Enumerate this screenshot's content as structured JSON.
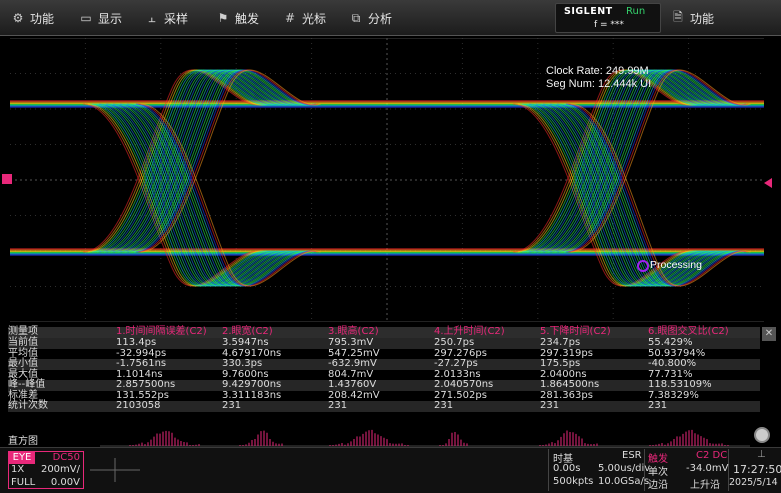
{
  "menu": {
    "items": [
      {
        "label": "功能",
        "icon": "gear-icon",
        "glyph": "⚙"
      },
      {
        "label": "显示",
        "icon": "display-icon",
        "glyph": "▭"
      },
      {
        "label": "采样",
        "icon": "acquire-icon",
        "glyph": "⫠"
      },
      {
        "label": "触发",
        "icon": "trigger-icon",
        "glyph": "⚑"
      },
      {
        "label": "光标",
        "icon": "cursor-icon",
        "glyph": "#"
      },
      {
        "label": "分析",
        "icon": "analysis-icon",
        "glyph": "⧉"
      }
    ],
    "brand": "SIGLENT",
    "run_status": "Run",
    "freq": "f = ***",
    "right_function": {
      "label": "功能",
      "icon": "file-icon",
      "glyph": "🗎"
    }
  },
  "scope": {
    "clock_rate": "Clock Rate: 249.99M",
    "seg_num": "Seg Num: 12.444k UI",
    "processing": "Processing"
  },
  "measurements": {
    "row_header": "测量项",
    "columns": [
      "1.时间间隔误差(C2)",
      "2.眼宽(C2)",
      "3.眼高(C2)",
      "4.上升时间(C2)",
      "5.下降时间(C2)",
      "6.眼图交叉比(C2)"
    ],
    "rows": [
      {
        "label": "当前值",
        "values": [
          "113.4ps",
          "3.5947ns",
          "795.3mV",
          "250.7ps",
          "234.7ps",
          "55.429%"
        ]
      },
      {
        "label": "平均值",
        "values": [
          "-32.994ps",
          "4.679170ns",
          "547.25mV",
          "297.276ps",
          "297.319ps",
          "50.93794%"
        ]
      },
      {
        "label": "最小值",
        "values": [
          "-1.7561ns",
          "330.3ps",
          "-632.9mV",
          "-27.27ps",
          "175.5ps",
          "-40.800%"
        ]
      },
      {
        "label": "最大值",
        "values": [
          "1.1014ns",
          "9.7600ns",
          "804.7mV",
          "2.0133ns",
          "2.0400ns",
          "77.731%"
        ]
      },
      {
        "label": "峰--峰值",
        "values": [
          "2.857500ns",
          "9.429700ns",
          "1.43760V",
          "2.040570ns",
          "1.864500ns",
          "118.53109%"
        ]
      },
      {
        "label": "标准差",
        "values": [
          "131.552ps",
          "3.311183ns",
          "208.42mV",
          "271.502ps",
          "281.363ps",
          "7.38329%"
        ]
      },
      {
        "label": "统计次数",
        "values": [
          "2103058",
          "231",
          "231",
          "231",
          "231",
          "231"
        ]
      }
    ],
    "histogram_label": "直方图",
    "close_glyph": "✕"
  },
  "channel": {
    "mode": "EYE",
    "coupling": "DC50",
    "probe": "1X",
    "scale": "200mV/",
    "bandwidth": "FULL",
    "offset": "0.00V"
  },
  "status": {
    "timebase_label": "时基",
    "esr": "ESR",
    "delay": "0.00s",
    "time_div": "5.00us/div",
    "points": "500kpts",
    "sample_rate": "10.0GSa/s",
    "trigger_label": "触发",
    "trigger_source": "C2 DC",
    "trigger_mode": "单次",
    "trigger_level": "-34.0mV",
    "trigger_type": "边沿",
    "trigger_slope": "上升沿",
    "time": "17:27:50",
    "date": "2025/5/14",
    "network_icon": "⊥"
  },
  "colors": {
    "accent": "#e8287a",
    "run_green": "#34d06b",
    "grid": "#3a3a3a"
  }
}
